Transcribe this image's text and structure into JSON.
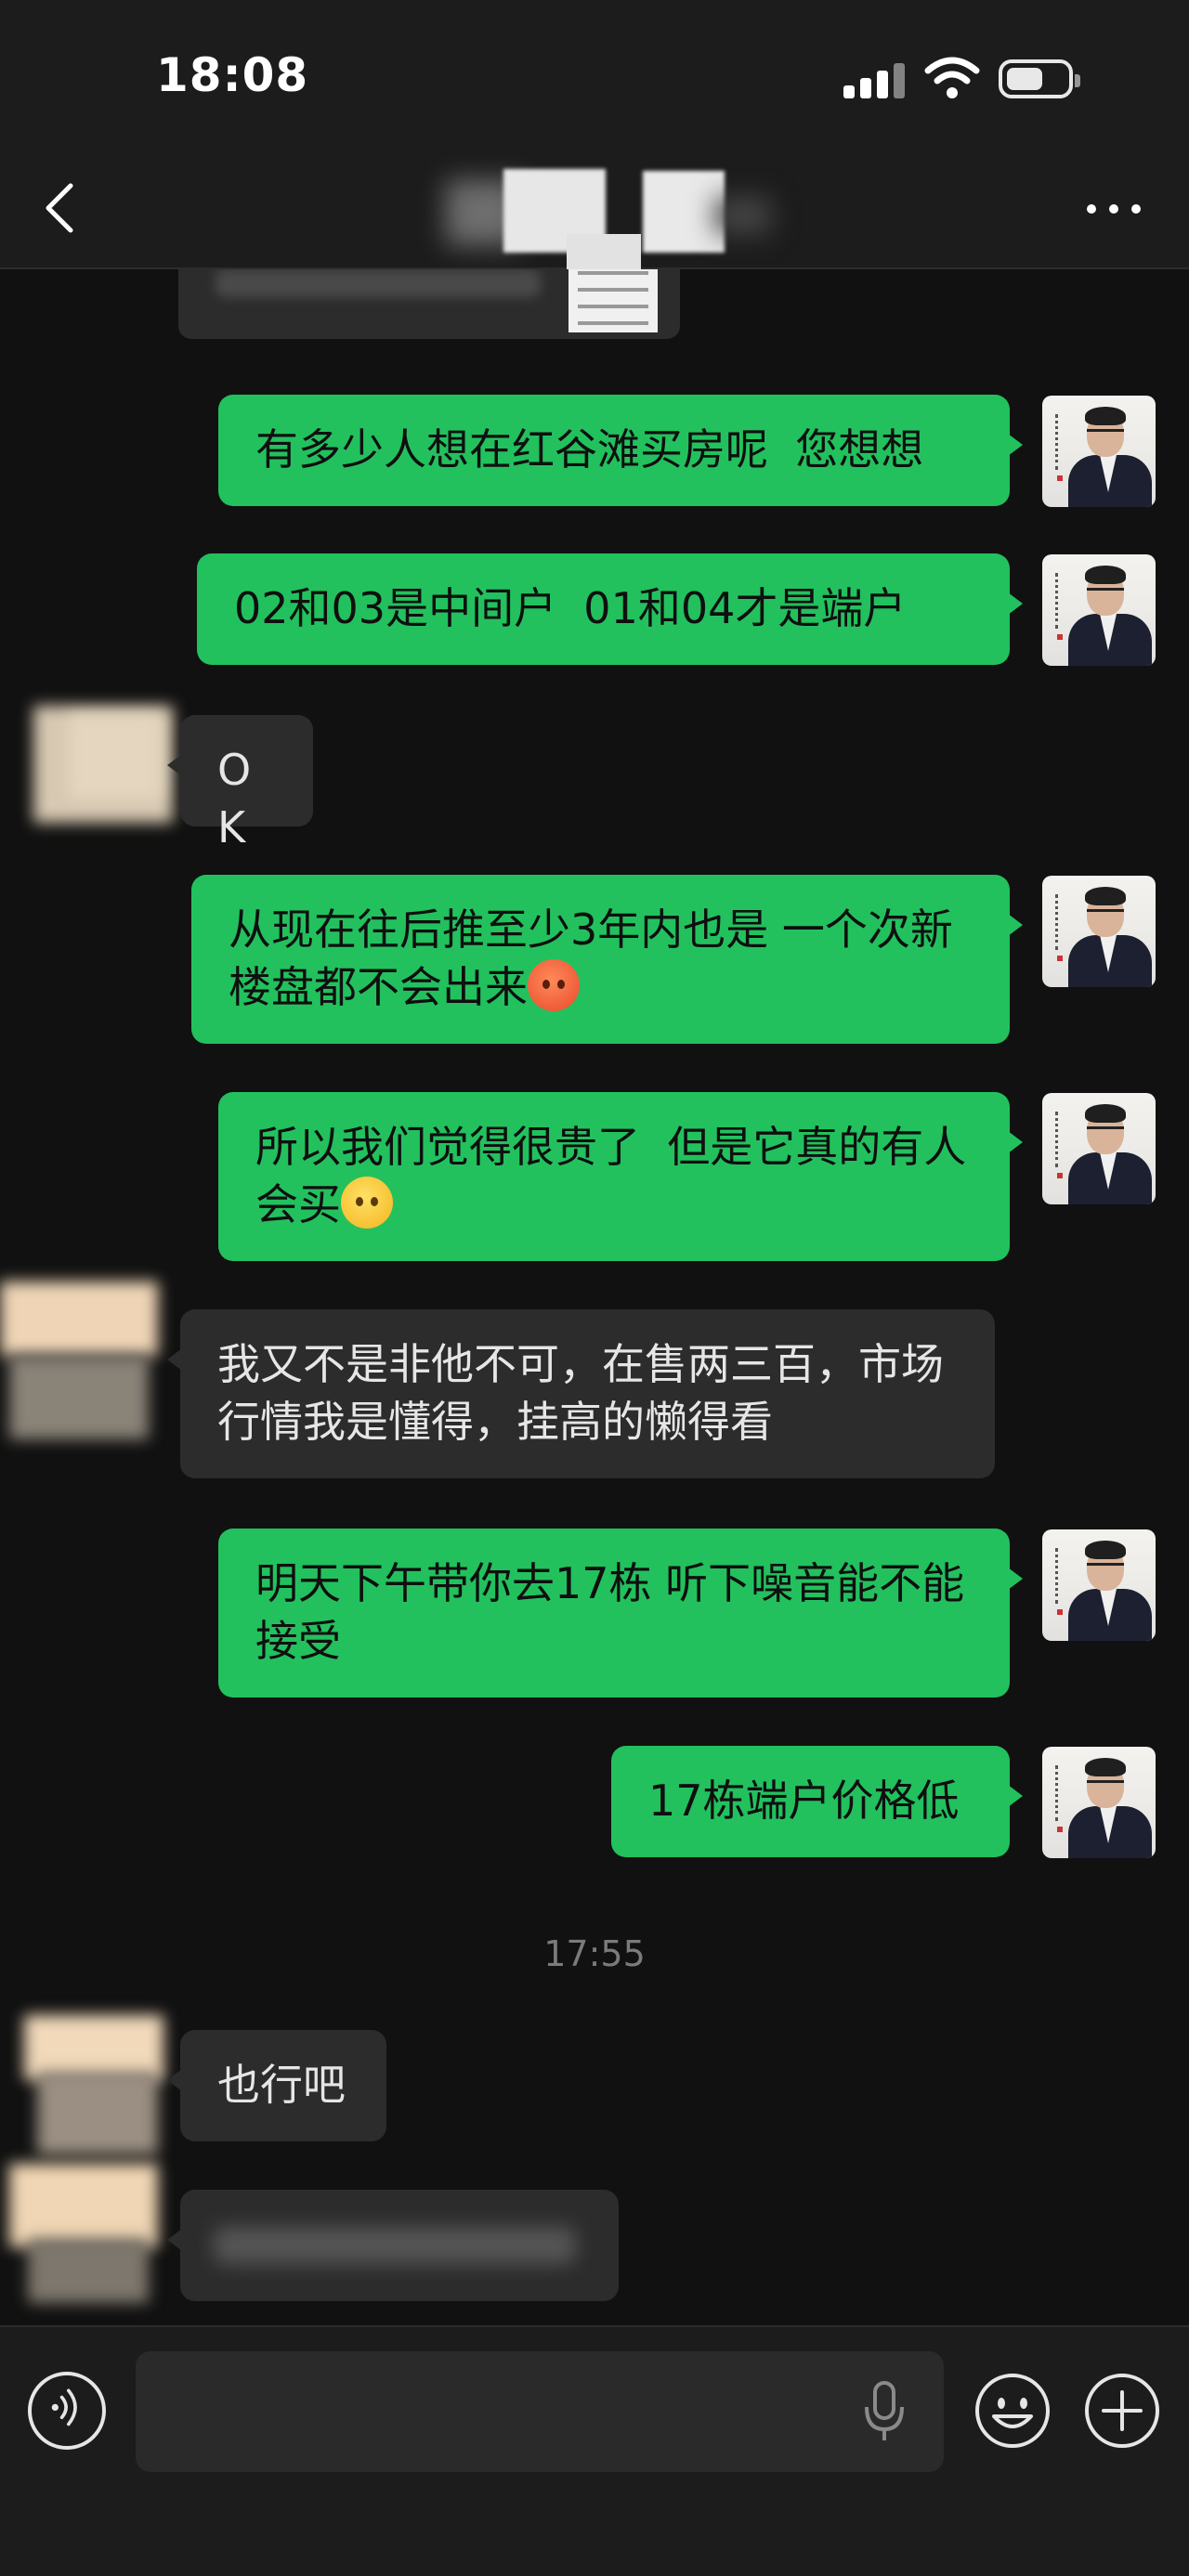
{
  "status_bar": {
    "time": "18:08"
  },
  "nav": {
    "title": ""
  },
  "chat": {
    "messages": [
      {
        "id": "m1",
        "side": "out",
        "text": "有多少人想在红谷滩买房呢  您想想"
      },
      {
        "id": "m2",
        "side": "out",
        "text": "02和03是中间户  01和04才是端户"
      },
      {
        "id": "m3",
        "side": "in",
        "text": "OK"
      },
      {
        "id": "m4",
        "side": "out",
        "text": "从现在往后推至少3年内也是 一个次新楼盘都不会出来",
        "emoji": "angry-face-emoji"
      },
      {
        "id": "m5",
        "side": "out",
        "text": "所以我们觉得很贵了  但是它真的有人会买",
        "emoji": "crying-face-emoji"
      },
      {
        "id": "m6",
        "side": "in",
        "text": "我又不是非他不可，在售两三百，市场行情我是懂得，挂高的懒得看"
      },
      {
        "id": "m7",
        "side": "out",
        "text": "明天下午带你去17栋 听下噪音能不能接受"
      },
      {
        "id": "m8",
        "side": "out",
        "text": "17栋端户价格低"
      },
      {
        "id": "m9",
        "side": "in",
        "text": "也行吧"
      }
    ],
    "timestamp": "17:55"
  },
  "input_bar": {
    "placeholder": ""
  },
  "colors": {
    "out_bubble": "#22c15e",
    "in_bubble": "#2c2c2c",
    "background": "#111111"
  }
}
